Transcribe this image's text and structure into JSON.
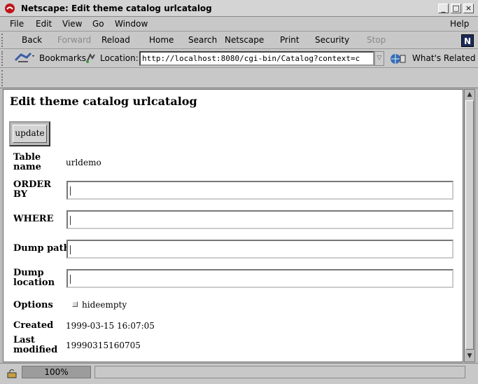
{
  "window": {
    "title": "Netscape: Edit theme catalog urlcatalog"
  },
  "menu": {
    "file": "File",
    "edit": "Edit",
    "view": "View",
    "go": "Go",
    "window": "Window",
    "help": "Help"
  },
  "toolbar": {
    "back": "Back",
    "forward": "Forward",
    "reload": "Reload",
    "home": "Home",
    "search": "Search",
    "netscape": "Netscape",
    "print": "Print",
    "security": "Security",
    "stop": "Stop",
    "logo": "N"
  },
  "location": {
    "bookmarks": "Bookmarks",
    "label": "Location:",
    "url": "http://localhost:8080/cgi-bin/Catalog?context=c",
    "related": "What's Related"
  },
  "page": {
    "heading": "Edit theme catalog urlcatalog",
    "update_button": "update",
    "table_name_label": "Table name",
    "table_name_value": "urldemo",
    "order_by_label": "ORDER BY",
    "order_by_value": "",
    "where_label": "WHERE",
    "where_value": "",
    "dump_path_label": "Dump path",
    "dump_path_value": "",
    "dump_location_label": "Dump location",
    "dump_location_value": "",
    "options_label": "Options",
    "hideempty_label": "hideempty",
    "created_label": "Created",
    "created_value": "1999-03-15 16:07:05",
    "modified_label": "Last modified",
    "modified_value": "19990315160705"
  },
  "status": {
    "zoom": "100%",
    "text": ""
  }
}
